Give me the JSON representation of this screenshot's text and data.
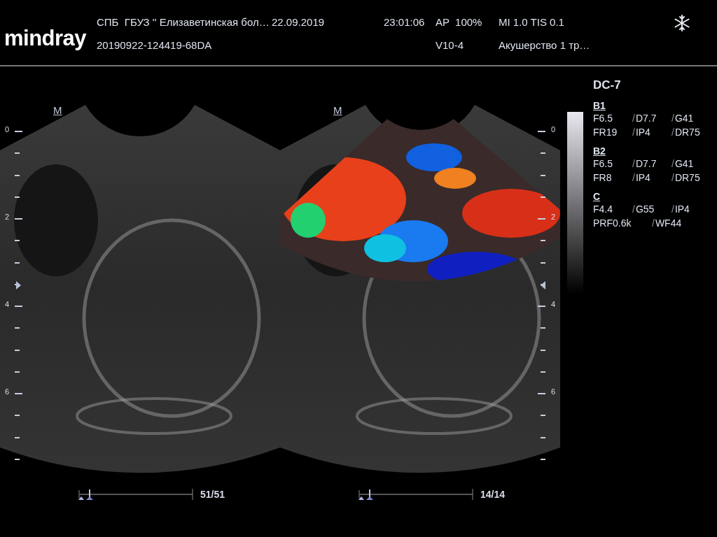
{
  "header": {
    "logo": "mindray",
    "institution": "СПБ  ГБУЗ '' Елизаветинская бол…",
    "date": "22.09.2019",
    "time": "23:01:06",
    "power": "AP  100%",
    "indices": "MI 1.0 TIS 0.1",
    "exam_id": "20190922-124419-68DA",
    "probe": "V10-4",
    "preset": "Акушерство 1 тр…"
  },
  "images": [
    {
      "kind": "bmode",
      "marker": "M",
      "depth_labels": [
        "0",
        "2",
        "4",
        "6"
      ],
      "frames": "51/51"
    },
    {
      "kind": "doppler",
      "marker": "M",
      "depth_labels": [
        "0",
        "2",
        "4",
        "6"
      ],
      "frames": "14/14"
    }
  ],
  "params": {
    "probe_title": "DC-7",
    "sections": [
      {
        "title": "B1",
        "rows": [
          [
            {
              "text": "F6.5"
            },
            {
              "sep": "/",
              "text": "D7.7"
            },
            {
              "sep": "/",
              "text": "G41"
            }
          ],
          [
            {
              "text": "FR19"
            },
            {
              "sep": "/",
              "text": "IP4"
            },
            {
              "sep": "/",
              "text": "DR75"
            }
          ]
        ]
      },
      {
        "title": "B2",
        "rows": [
          [
            {
              "text": "F6.5"
            },
            {
              "sep": "/",
              "text": "D7.7"
            },
            {
              "sep": "/",
              "text": "G41"
            }
          ],
          [
            {
              "text": "FR8"
            },
            {
              "sep": "/",
              "text": "IP4"
            },
            {
              "sep": "/",
              "text": "DR75"
            }
          ]
        ]
      },
      {
        "title": "C",
        "rows": [
          [
            {
              "text": "F4.4"
            },
            {
              "sep": "/",
              "text": "G55"
            },
            {
              "sep": "/",
              "text": "IP4"
            }
          ],
          [
            {
              "text": "PRF0.6k"
            },
            {
              "sep": "/",
              "text": "WF44"
            }
          ]
        ]
      }
    ]
  }
}
